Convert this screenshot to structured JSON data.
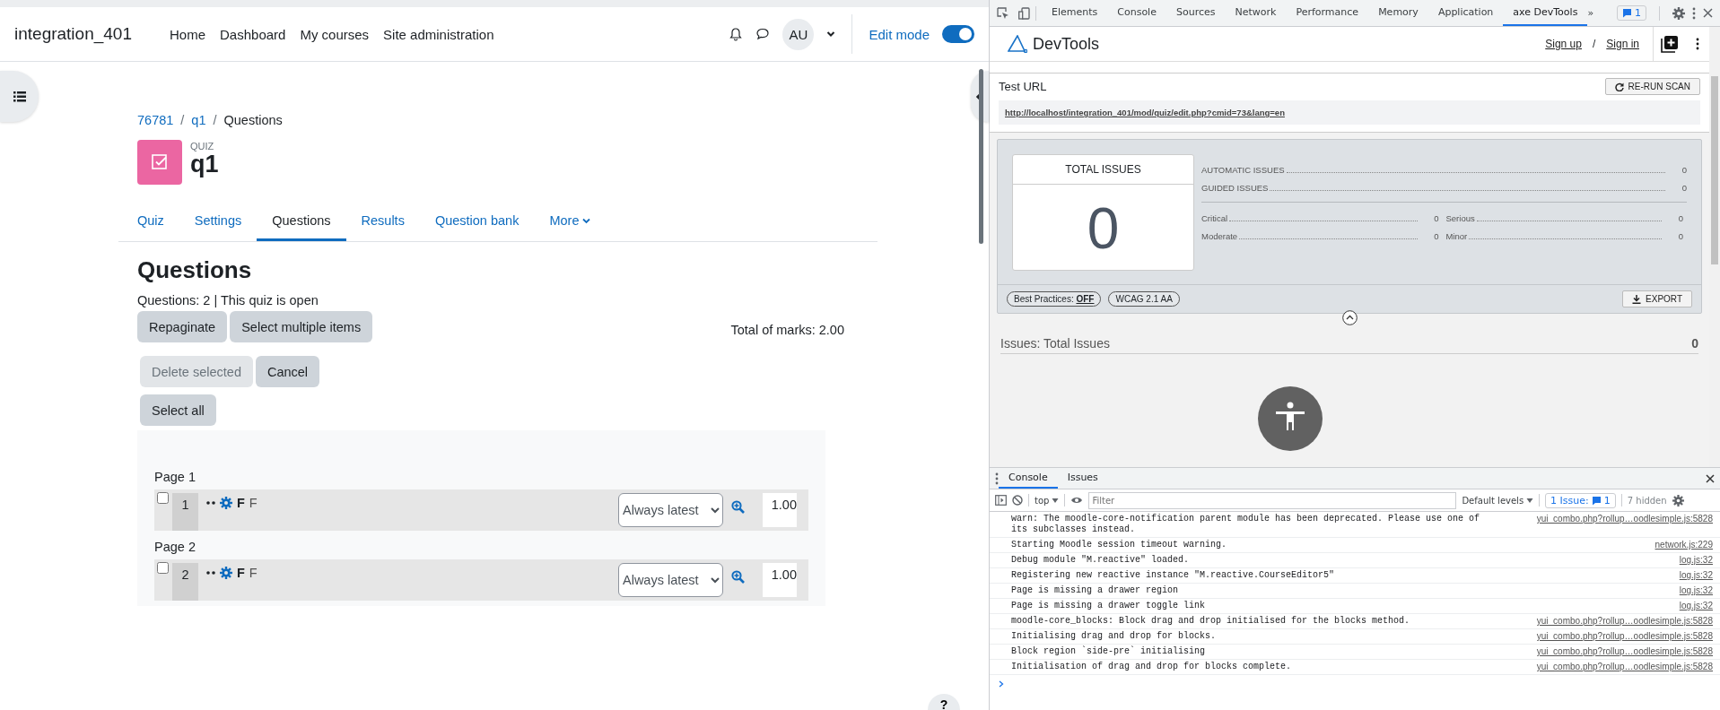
{
  "page": {
    "site_name": "integration_401",
    "nav": [
      {
        "label": "Home"
      },
      {
        "label": "Dashboard"
      },
      {
        "label": "My courses"
      },
      {
        "label": "Site administration"
      }
    ],
    "user_initials": "AU",
    "edit_mode": {
      "label": "Edit mode",
      "on": true
    },
    "breadcrumb": [
      {
        "label": "76781",
        "link": true
      },
      {
        "label": "q1",
        "link": true
      },
      {
        "label": "Questions",
        "link": false
      }
    ],
    "breadcrumb_separator": "/",
    "activity": {
      "type_label": "QUIZ",
      "name": "q1"
    },
    "tabs": [
      {
        "label": "Quiz",
        "selected": false
      },
      {
        "label": "Settings",
        "selected": false
      },
      {
        "label": "Questions",
        "selected": true
      },
      {
        "label": "Results",
        "selected": false
      },
      {
        "label": "Question bank",
        "selected": false
      },
      {
        "label": "More",
        "selected": false,
        "dropdown": true
      }
    ],
    "heading": "Questions",
    "summary": "Questions: 2 | This quiz is open",
    "toolbar_buttons": [
      {
        "label": "Repaginate"
      },
      {
        "label": "Select multiple items"
      }
    ],
    "total_marks": "Total of marks: 2.00",
    "bulk_buttons": [
      {
        "label": "Delete selected",
        "disabled": true
      },
      {
        "label": "Cancel",
        "disabled": false
      }
    ],
    "select_all": "Select all",
    "pages": [
      {
        "title": "Page 1",
        "questions": [
          {
            "number": "1",
            "checked": false,
            "name": "F",
            "text": "F",
            "version": "Always latest",
            "mark": "1.00"
          }
        ]
      },
      {
        "title": "Page 2",
        "questions": [
          {
            "number": "2",
            "checked": false,
            "name": "F",
            "text": "F",
            "version": "Always latest",
            "mark": "1.00"
          }
        ]
      }
    ],
    "help": "?"
  },
  "devtools": {
    "tabs": [
      {
        "label": "Elements",
        "selected": false
      },
      {
        "label": "Console",
        "selected": false
      },
      {
        "label": "Sources",
        "selected": false
      },
      {
        "label": "Network",
        "selected": false
      },
      {
        "label": "Performance",
        "selected": false
      },
      {
        "label": "Memory",
        "selected": false
      },
      {
        "label": "Application",
        "selected": false
      },
      {
        "label": "axe DevTools",
        "selected": true
      }
    ],
    "more_tabs": "»",
    "issue_badge": "1",
    "axe": {
      "brand": "DevTools",
      "links": [
        "Sign up",
        "Sign in"
      ],
      "link_separator": "/",
      "test_url_label": "Test URL",
      "rerun": "RE-RUN SCAN",
      "url": "http://localhost/integration_401/mod/quiz/edit.php?cmid=73&lang=en",
      "total_label": "TOTAL ISSUES",
      "total": "0",
      "breakdown": [
        {
          "label": "AUTOMATIC ISSUES",
          "value": "0"
        },
        {
          "label": "GUIDED ISSUES",
          "value": "0"
        }
      ],
      "severity": [
        {
          "label": "Critical",
          "value": "0"
        },
        {
          "label": "Serious",
          "value": "0"
        },
        {
          "label": "Moderate",
          "value": "0"
        },
        {
          "label": "Minor",
          "value": "0"
        }
      ],
      "best_practices": {
        "label": "Best Practices:",
        "value": "OFF"
      },
      "standard": "WCAG 2.1 AA",
      "export": "EXPORT",
      "issues_title": "Issues: Total Issues",
      "issues_count": "0"
    },
    "drawer": {
      "tabs": [
        {
          "label": "Console",
          "selected": true
        },
        {
          "label": "Issues",
          "selected": false
        }
      ],
      "context": "top",
      "filter_placeholder": "Filter",
      "levels": "Default levels",
      "issues_label": "1 Issue:",
      "issues_count": "1",
      "hidden": "7 hidden",
      "messages": [
        {
          "text": "warn: The moodle-core-notification parent module has been deprecated. Please use one of its subclasses instead.",
          "source": "yui_combo.php?rollup…oodlesimple.js:5828"
        },
        {
          "text": "Starting Moodle session timeout warning.",
          "source": "network.js:229"
        },
        {
          "text": "Debug module \"M.reactive\" loaded.",
          "source": "log.js:32"
        },
        {
          "text": "Registering new reactive instance \"M.reactive.CourseEditor5\"",
          "source": "log.js:32"
        },
        {
          "text": "Page is missing a drawer region",
          "source": "log.js:32"
        },
        {
          "text": "Page is missing a drawer toggle link",
          "source": "log.js:32"
        },
        {
          "text": "moodle-core_blocks: Block drag and drop initialised for the blocks method.",
          "source": "yui_combo.php?rollup…oodlesimple.js:5828"
        },
        {
          "text": "Initialising drag and drop for blocks.",
          "source": "yui_combo.php?rollup…oodlesimple.js:5828"
        },
        {
          "text": "Block region `side-pre` initialising",
          "source": "yui_combo.php?rollup…oodlesimple.js:5828"
        },
        {
          "text": "Initialisation of drag and drop for blocks complete.",
          "source": "yui_combo.php?rollup…oodlesimple.js:5828"
        }
      ]
    }
  }
}
